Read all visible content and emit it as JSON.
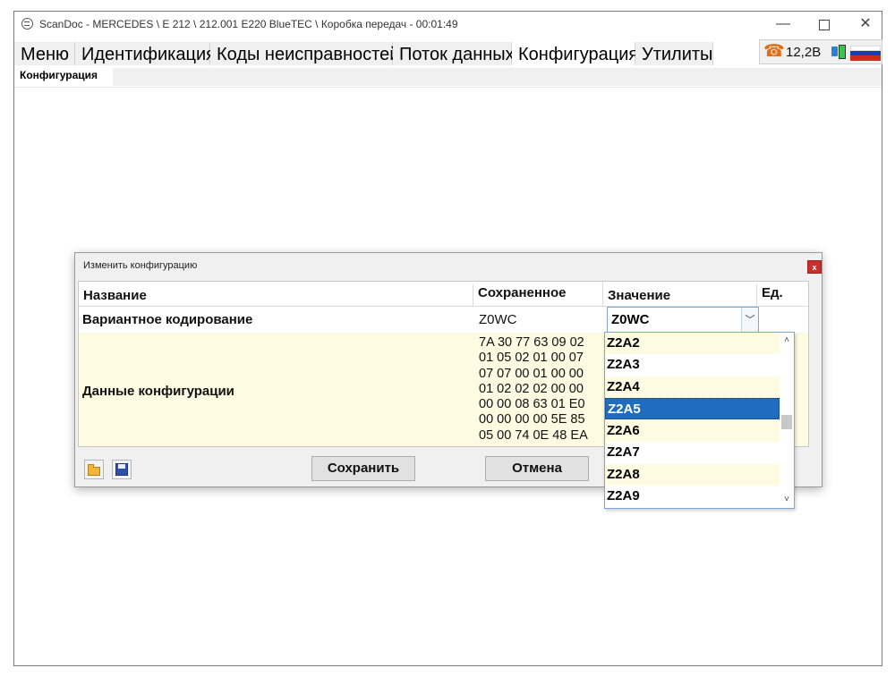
{
  "window": {
    "title": "ScanDoc - MERCEDES \\ E 212 \\ 212.001 E220 BlueTEC \\ Коробка передач - 00:01:49",
    "minimize": "—",
    "close": "✕"
  },
  "menu": {
    "items": [
      "Меню",
      "Идентификация",
      "Коды неисправностей",
      "Поток данных",
      "Конфигурация",
      "Утилиты"
    ],
    "active": "Конфигурация"
  },
  "status": {
    "voltage": "12,2В"
  },
  "subtabs": {
    "active": "Конфигурация"
  },
  "dialog": {
    "title": "Изменить конфигурацию",
    "close": "x",
    "columns": {
      "name": "Название",
      "saved": "Сохраненное",
      "value": "Значение",
      "unit": "Ед."
    },
    "rows": [
      {
        "name": "Вариантное кодирование",
        "saved": "Z0WC",
        "value": "Z0WC"
      },
      {
        "name": "Данные конфигурации",
        "saved_lines": [
          "7A 30 77 63 09 02",
          "01 05 02 01 00 07",
          "07 07 00 01 00 00",
          "01 02 02 02 00 00",
          "00 00 08 63 01 E0",
          "00 00 00 00 5E 85",
          "05 00 74 0E 48 EA"
        ]
      }
    ],
    "buttons": {
      "save": "Сохранить",
      "cancel": "Отмена"
    }
  },
  "dropdown": {
    "options": [
      "Z2A2",
      "Z2A3",
      "Z2A4",
      "Z2A5",
      "Z2A6",
      "Z2A7",
      "Z2A8",
      "Z2A9"
    ],
    "selected": "Z2A5",
    "scroll_up": "˄",
    "scroll_down": "˅"
  },
  "colors": {
    "selection": "#1e6dc0",
    "row_highlight": "#fdfbe2",
    "close_button": "#c9302c",
    "phone": "#e06c14"
  }
}
